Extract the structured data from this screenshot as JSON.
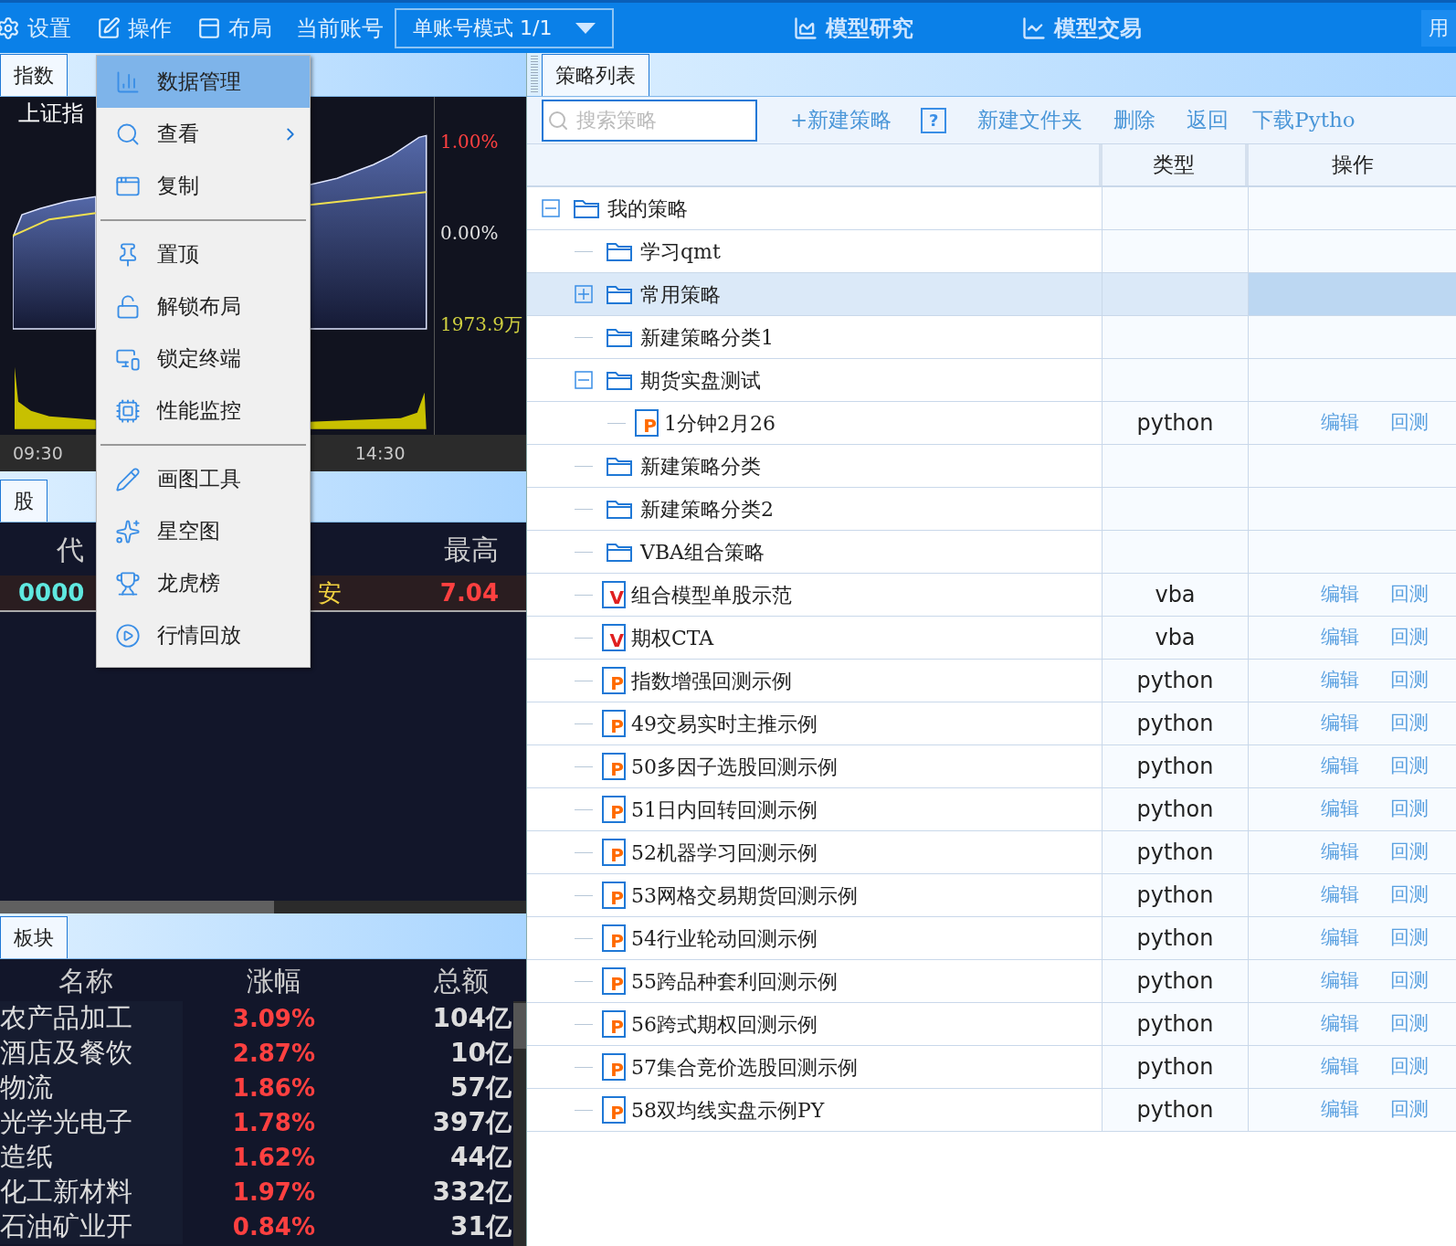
{
  "top_bar": {
    "menus": [
      {
        "label": "设置"
      },
      {
        "label": "操作"
      },
      {
        "label": "布局"
      }
    ],
    "account_label": "当前账号",
    "account_select": "单账号模式 1/1",
    "modes": [
      {
        "label": "模型研究"
      },
      {
        "label": "模型交易"
      }
    ],
    "cut_label": "用"
  },
  "index_panel": {
    "tab": "指数",
    "title": "上证指",
    "price_labels": [
      "1.00%",
      "0.00%"
    ],
    "volume_label": "1973.9万",
    "times": [
      "09:30",
      "14:30"
    ]
  },
  "stock_panel": {
    "tab": "股",
    "columns": [
      "代",
      "最高"
    ],
    "row": {
      "code": "0000",
      "name": "安",
      "high": "7.04"
    }
  },
  "sector_panel": {
    "tab": "板块",
    "columns": [
      "名称",
      "涨幅",
      "总额"
    ],
    "rows": [
      {
        "name": "农产品加工",
        "change": "3.09%",
        "amount": "104亿"
      },
      {
        "name": "酒店及餐饮",
        "change": "2.87%",
        "amount": "10亿"
      },
      {
        "name": "物流",
        "change": "1.86%",
        "amount": "57亿"
      },
      {
        "name": "光学光电子",
        "change": "1.78%",
        "amount": "397亿"
      },
      {
        "name": "造纸",
        "change": "1.62%",
        "amount": "44亿"
      },
      {
        "name": "化工新材料",
        "change": "1.97%",
        "amount": "332亿"
      },
      {
        "name": "石油矿业开",
        "change": "0.84%",
        "amount": "31亿"
      }
    ]
  },
  "context_menu": {
    "items": [
      {
        "label": "数据管理",
        "selected": true,
        "submenu": false,
        "separator_after": false
      },
      {
        "label": "查看",
        "selected": false,
        "submenu": true,
        "separator_after": false
      },
      {
        "label": "复制",
        "selected": false,
        "submenu": false,
        "separator_after": true
      },
      {
        "label": "置顶",
        "selected": false,
        "submenu": false,
        "separator_after": false
      },
      {
        "label": "解锁布局",
        "selected": false,
        "submenu": false,
        "separator_after": false
      },
      {
        "label": "锁定终端",
        "selected": false,
        "submenu": false,
        "separator_after": false
      },
      {
        "label": "性能监控",
        "selected": false,
        "submenu": false,
        "separator_after": true
      },
      {
        "label": "画图工具",
        "selected": false,
        "submenu": false,
        "separator_after": false
      },
      {
        "label": "星空图",
        "selected": false,
        "submenu": false,
        "separator_after": false
      },
      {
        "label": "龙虎榜",
        "selected": false,
        "submenu": false,
        "separator_after": false
      },
      {
        "label": "行情回放",
        "selected": false,
        "submenu": false,
        "separator_after": false
      }
    ]
  },
  "strategy_panel": {
    "tab": "策略列表",
    "search": {
      "placeholder": "搜索策略"
    },
    "actions": [
      {
        "kind": "link",
        "label": "+新建策略"
      },
      {
        "kind": "help",
        "label": "?"
      },
      {
        "kind": "link",
        "label": "新建文件夹"
      },
      {
        "kind": "link",
        "label": "删除"
      },
      {
        "kind": "link",
        "label": "返回"
      },
      {
        "kind": "link",
        "label": "下载Pytho"
      }
    ],
    "columns": [
      "类型",
      "操作"
    ],
    "tree": [
      {
        "kind": "folder",
        "name": "我的策略",
        "expanded": true,
        "selected": false,
        "children": [
          {
            "kind": "folder",
            "name": "学习qmt",
            "selected": false
          },
          {
            "kind": "folder",
            "name": "常用策略",
            "expanded": false,
            "selected": true
          },
          {
            "kind": "folder",
            "name": "新建策略分类1",
            "selected": false
          },
          {
            "kind": "folder",
            "name": "期货实盘测试",
            "expanded": true,
            "selected": false,
            "children": [
              {
                "kind": "file",
                "name": "1分钟2月26",
                "letter": "P",
                "type": "python",
                "edit": "编辑",
                "backtest": "回测",
                "selected": false
              }
            ]
          },
          {
            "kind": "folder",
            "name": "新建策略分类",
            "selected": false
          },
          {
            "kind": "folder",
            "name": "新建策略分类2",
            "selected": false
          },
          {
            "kind": "folder",
            "name": "VBA组合策略",
            "selected": false
          },
          {
            "kind": "file",
            "name": "组合模型单股示范",
            "letter": "V",
            "type": "vba",
            "edit": "编辑",
            "backtest": "回测",
            "selected": false
          },
          {
            "kind": "file",
            "name": "期权CTA",
            "letter": "V",
            "type": "vba",
            "edit": "编辑",
            "backtest": "回测",
            "selected": false
          },
          {
            "kind": "file",
            "name": "指数增强回测示例",
            "letter": "P",
            "type": "python",
            "edit": "编辑",
            "backtest": "回测",
            "selected": false
          },
          {
            "kind": "file",
            "name": "49交易实时主推示例",
            "letter": "P",
            "type": "python",
            "edit": "编辑",
            "backtest": "回测",
            "selected": false
          },
          {
            "kind": "file",
            "name": "50多因子选股回测示例",
            "letter": "P",
            "type": "python",
            "edit": "编辑",
            "backtest": "回测",
            "selected": false
          },
          {
            "kind": "file",
            "name": "51日内回转回测示例",
            "letter": "P",
            "type": "python",
            "edit": "编辑",
            "backtest": "回测",
            "selected": false
          },
          {
            "kind": "file",
            "name": "52机器学习回测示例",
            "letter": "P",
            "type": "python",
            "edit": "编辑",
            "backtest": "回测",
            "selected": false
          },
          {
            "kind": "file",
            "name": "53网格交易期货回测示例",
            "letter": "P",
            "type": "python",
            "edit": "编辑",
            "backtest": "回测",
            "selected": false
          },
          {
            "kind": "file",
            "name": "54行业轮动回测示例",
            "letter": "P",
            "type": "python",
            "edit": "编辑",
            "backtest": "回测",
            "selected": false
          },
          {
            "kind": "file",
            "name": "55跨品种套利回测示例",
            "letter": "P",
            "type": "python",
            "edit": "编辑",
            "backtest": "回测",
            "selected": false
          },
          {
            "kind": "file",
            "name": "56跨式期权回测示例",
            "letter": "P",
            "type": "python",
            "edit": "编辑",
            "backtest": "回测",
            "selected": false
          },
          {
            "kind": "file",
            "name": "57集合竞价选股回测示例",
            "letter": "P",
            "type": "python",
            "edit": "编辑",
            "backtest": "回测",
            "selected": false
          },
          {
            "kind": "file",
            "name": "58双均线实盘示例PY",
            "letter": "P",
            "type": "python",
            "edit": "编辑",
            "backtest": "回测",
            "selected": false
          }
        ]
      }
    ]
  }
}
